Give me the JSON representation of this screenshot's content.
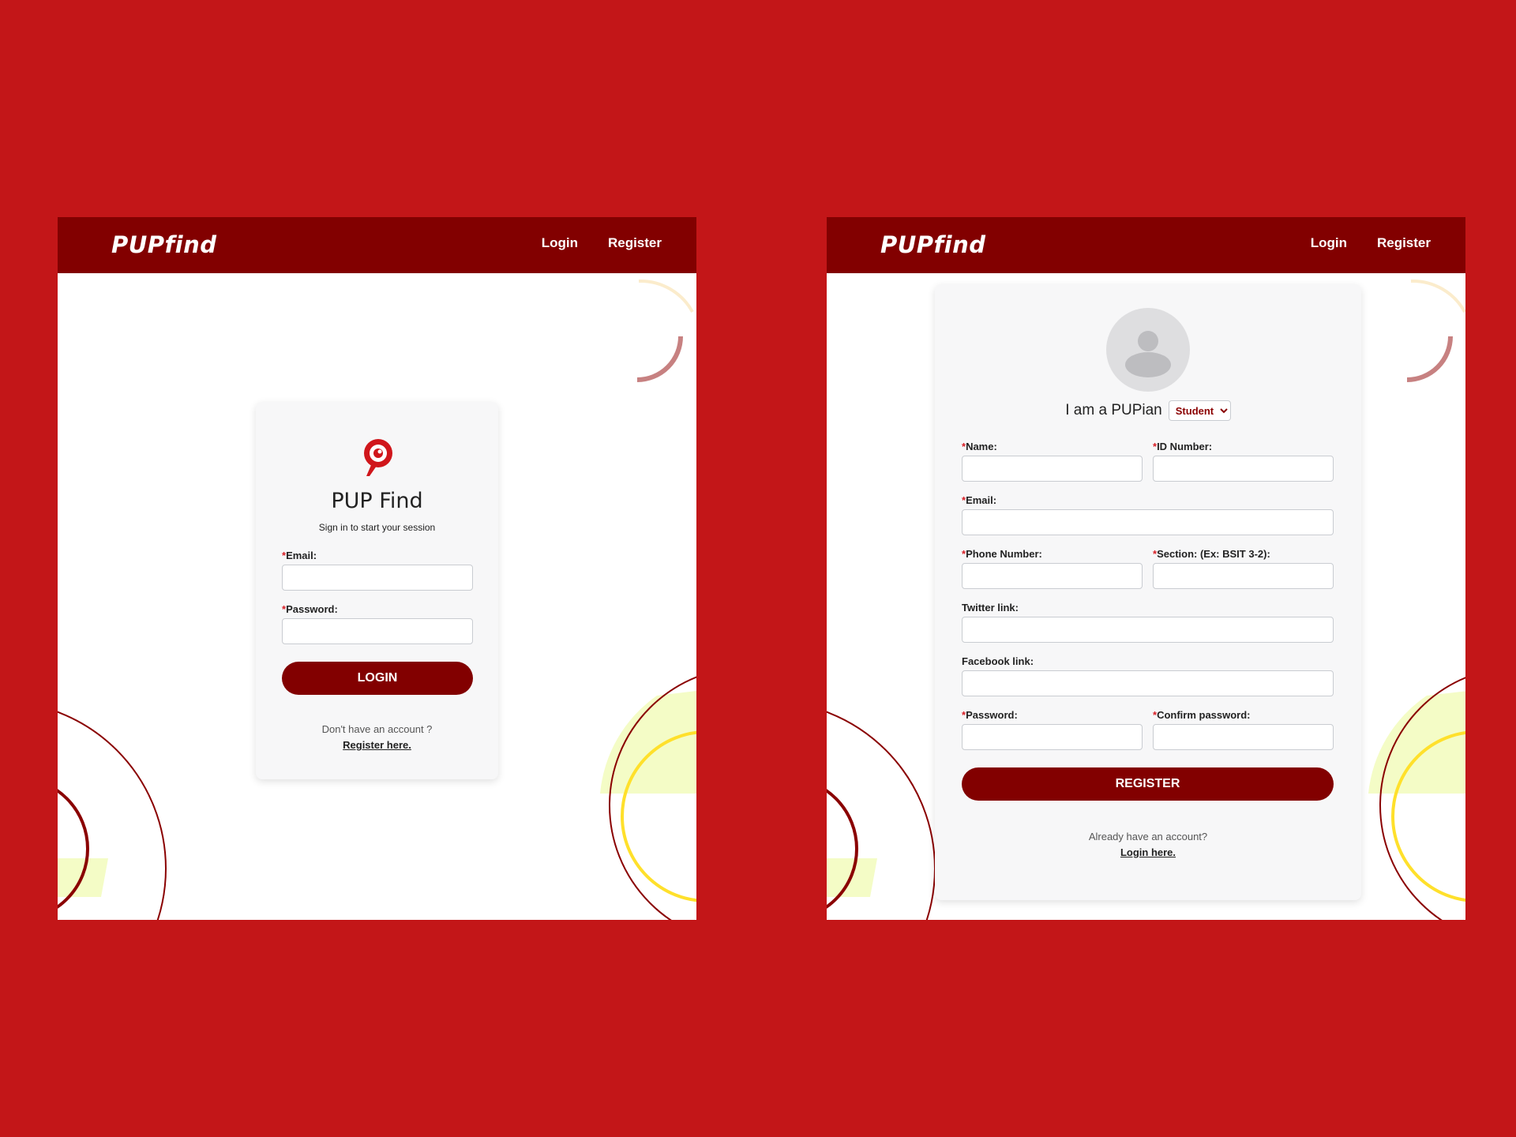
{
  "brand": "PUPfind",
  "nav": {
    "login": "Login",
    "register": "Register"
  },
  "login": {
    "app_name": "PUP Find",
    "subtitle": "Sign in to start your session",
    "email_label": "Email:",
    "password_label": "Password:",
    "button": "LOGIN",
    "footer_text": "Don't have an account ?",
    "footer_link": "Register here."
  },
  "register": {
    "role_prefix": "I am a PUPian",
    "role_options": [
      "Student"
    ],
    "role_selected": "Student",
    "fields": {
      "name": "Name:",
      "id_number": "ID Number:",
      "email": "Email:",
      "phone": "Phone Number:",
      "section": "Section: (Ex: BSIT 3-2):",
      "twitter": "Twitter link:",
      "facebook": "Facebook link:",
      "password": "Password:",
      "confirm_password": "Confirm password:"
    },
    "button": "REGISTER",
    "footer_text": "Already have an account?",
    "footer_link": "Login here."
  },
  "colors": {
    "background": "#c31618",
    "navbar": "#820000",
    "button": "#820000",
    "required": "#d81f26"
  },
  "icons": {
    "logo": "location-search-pin-icon",
    "avatar": "user-avatar-icon",
    "select_arrow": "chevron-down-icon"
  }
}
